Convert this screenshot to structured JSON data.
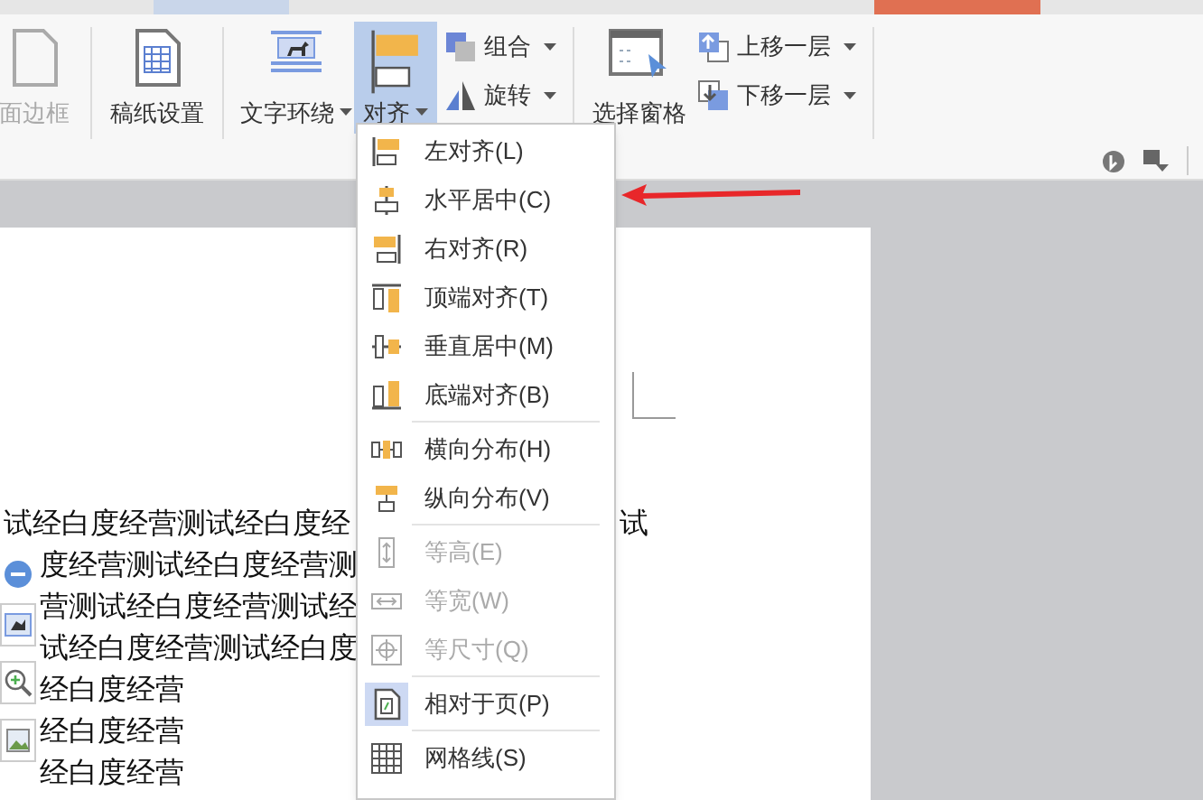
{
  "ribbon": {
    "buttons": [
      {
        "label": "面边框",
        "kind": "large",
        "disabled": true,
        "selected": false,
        "dropdown": false
      },
      {
        "label": "稿纸设置",
        "kind": "large",
        "disabled": false,
        "selected": false,
        "dropdown": false
      },
      {
        "label": "文字环绕",
        "kind": "large",
        "disabled": false,
        "selected": false,
        "dropdown": true
      },
      {
        "label": "对齐",
        "kind": "large",
        "disabled": false,
        "selected": true,
        "dropdown": true
      },
      {
        "label": "组合",
        "kind": "small",
        "disabled": false,
        "selected": false,
        "dropdown": true
      },
      {
        "label": "旋转",
        "kind": "small",
        "disabled": false,
        "selected": false,
        "dropdown": true
      },
      {
        "label": "选择窗格",
        "kind": "large",
        "disabled": false,
        "selected": false,
        "dropdown": false
      },
      {
        "label": "上移一层",
        "kind": "small",
        "disabled": false,
        "selected": false,
        "dropdown": true
      },
      {
        "label": "下移一层",
        "kind": "small",
        "disabled": false,
        "selected": false,
        "dropdown": true
      }
    ]
  },
  "align_menu": {
    "items": [
      {
        "kind": "item",
        "label": "左对齐(L)",
        "disabled": false,
        "checked": false
      },
      {
        "kind": "item",
        "label": "水平居中(C)",
        "disabled": false,
        "checked": false
      },
      {
        "kind": "item",
        "label": "右对齐(R)",
        "disabled": false,
        "checked": false
      },
      {
        "kind": "item",
        "label": "顶端对齐(T)",
        "disabled": false,
        "checked": false
      },
      {
        "kind": "item",
        "label": "垂直居中(M)",
        "disabled": false,
        "checked": false
      },
      {
        "kind": "item",
        "label": "底端对齐(B)",
        "disabled": false,
        "checked": false
      },
      {
        "kind": "separator"
      },
      {
        "kind": "item",
        "label": "横向分布(H)",
        "disabled": false,
        "checked": false
      },
      {
        "kind": "item",
        "label": "纵向分布(V)",
        "disabled": false,
        "checked": false
      },
      {
        "kind": "separator"
      },
      {
        "kind": "item",
        "label": "等高(E)",
        "disabled": true,
        "checked": false
      },
      {
        "kind": "item",
        "label": "等宽(W)",
        "disabled": true,
        "checked": false
      },
      {
        "kind": "item",
        "label": "等尺寸(Q)",
        "disabled": true,
        "checked": false
      },
      {
        "kind": "separator"
      },
      {
        "kind": "item",
        "label": "相对于页(P)",
        "disabled": false,
        "checked": true
      },
      {
        "kind": "separator"
      },
      {
        "kind": "item",
        "label": "网格线(S)",
        "disabled": false,
        "checked": false
      }
    ]
  },
  "document": {
    "lines": [
      {
        "left": "试经白度经营测试经白度经",
        "right": "试"
      },
      {
        "left": "度经营测试经白度经营测"
      },
      {
        "left": "营测试经白度经营测试经"
      },
      {
        "left": "试经白度经营测试经白度"
      },
      {
        "left": "经白度经营"
      },
      {
        "left": "经白度经营"
      },
      {
        "left": "经白度经营"
      }
    ]
  }
}
